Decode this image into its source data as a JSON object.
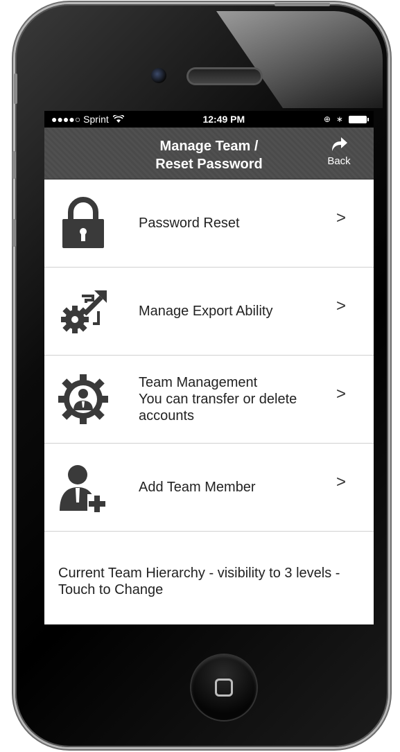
{
  "status_bar": {
    "carrier": "●●●●○ Sprint",
    "wifi_icon": "wifi-icon",
    "time": "12:49 PM",
    "battery_icon": "battery-icon"
  },
  "nav": {
    "title_line1": "Manage Team /",
    "title_line2": "Reset Password",
    "back_label": "Back"
  },
  "menu": [
    {
      "label": "Password Reset",
      "icon": "lock-icon",
      "chevron": ">"
    },
    {
      "label": "Manage Export Ability",
      "icon": "export-gear-icon",
      "chevron": ">"
    },
    {
      "label": "Team Management",
      "sublabel": "You can transfer or delete accounts",
      "icon": "team-gear-icon",
      "chevron": ">"
    },
    {
      "label": "Add Team Member",
      "icon": "add-user-icon",
      "chevron": ">"
    }
  ],
  "hierarchy_text": "Current Team Hierarchy - visibility to 3 levels - Touch to Change",
  "colors": {
    "nav_background": "#4d4d4d",
    "icon_color": "#3a3a3a",
    "screen_background": "#ffffff"
  }
}
